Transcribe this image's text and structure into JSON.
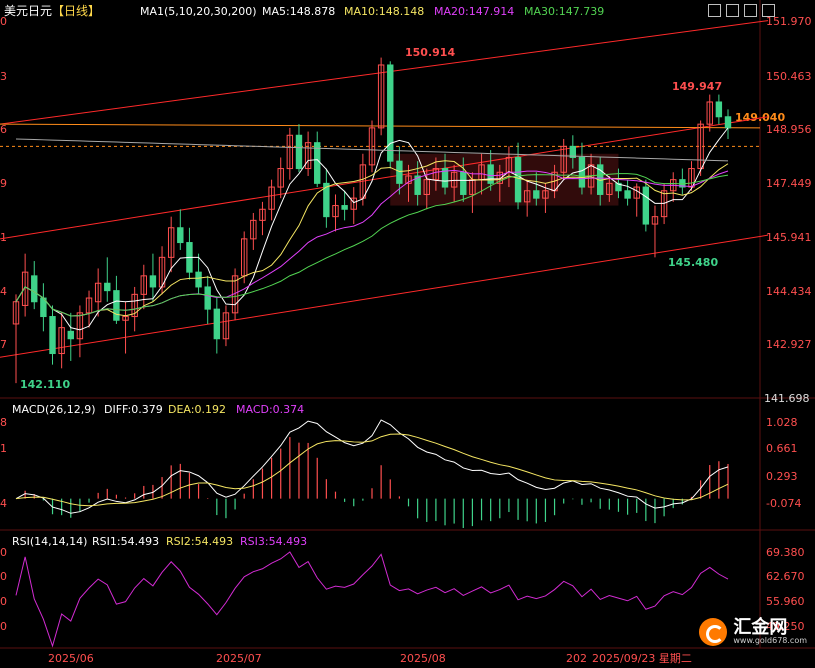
{
  "header": {
    "title": "美元日元",
    "period": "【日线】",
    "ma_label": "MA1(5,10,20,30,200)",
    "ma5": "MA5:148.878",
    "ma10": "MA10:148.148",
    "ma20": "MA20:147.914",
    "ma30": "MA30:147.739"
  },
  "macd_header": {
    "label": "MACD(26,12,9)",
    "diff": "DIFF:0.379",
    "dea": "DEA:0.192",
    "macd": "MACD:0.374"
  },
  "rsi_header": {
    "label": "RSI(14,14,14)",
    "rsi1": "RSI1:54.493",
    "rsi2": "RSI2:54.493",
    "rsi3": "RSI3:54.493"
  },
  "price_axis": [
    "151.970",
    "150.463",
    "148.956",
    "147.449",
    "145.941",
    "144.434",
    "142.927",
    "141.698"
  ],
  "macd_axis": [
    "1.028",
    "0.661",
    "0.293",
    "-0.074"
  ],
  "rsi_axis": [
    "69.380",
    "62.670",
    "55.960",
    "49.250"
  ],
  "left_axis_fragments": [
    "0",
    "3",
    "6",
    "9",
    "1",
    "4",
    "7",
    "8",
    "1",
    "4",
    "0",
    "0",
    "0",
    "0"
  ],
  "annotations": {
    "high": "150.914",
    "high2": "149.947",
    "last_price": "149.040",
    "low_recent": "145.480",
    "low": "142.110"
  },
  "x_axis": [
    "2025/06",
    "2025/07",
    "2025/08",
    "202",
    "2025/09/23 星期二"
  ],
  "watermark": {
    "text": "汇金网",
    "url": "www.gold678.com"
  },
  "colors": {
    "up": "#ff4f4f",
    "down": "#3fd38a",
    "ma5": "#ffffff",
    "ma10": "#f5e663",
    "ma20": "#e040fb",
    "ma30": "#52d452",
    "ma200": "#a8a8a8",
    "trend": "#ff2a2a",
    "macd_diff": "#ffffff",
    "macd_dea": "#f5e663",
    "rsi": "#d22bd2"
  },
  "chart_data": {
    "type": "candlestick",
    "title": "美元日元",
    "y_range": [
      141.698,
      151.97
    ],
    "candles": [
      {
        "o": 143.7,
        "h": 144.5,
        "l": 142.1,
        "c": 144.3
      },
      {
        "o": 144.2,
        "h": 145.6,
        "l": 143.9,
        "c": 145.1
      },
      {
        "o": 145.0,
        "h": 145.4,
        "l": 144.1,
        "c": 144.3
      },
      {
        "o": 144.4,
        "h": 144.8,
        "l": 143.5,
        "c": 143.9
      },
      {
        "o": 143.9,
        "h": 144.2,
        "l": 142.6,
        "c": 142.9
      },
      {
        "o": 142.9,
        "h": 144.0,
        "l": 142.5,
        "c": 143.6
      },
      {
        "o": 143.5,
        "h": 144.0,
        "l": 142.7,
        "c": 143.3
      },
      {
        "o": 143.3,
        "h": 144.2,
        "l": 142.8,
        "c": 144.0
      },
      {
        "o": 144.0,
        "h": 144.6,
        "l": 143.6,
        "c": 144.4
      },
      {
        "o": 144.3,
        "h": 145.2,
        "l": 143.9,
        "c": 144.8
      },
      {
        "o": 144.8,
        "h": 145.5,
        "l": 144.3,
        "c": 144.6
      },
      {
        "o": 144.6,
        "h": 145.0,
        "l": 143.7,
        "c": 143.8
      },
      {
        "o": 143.8,
        "h": 144.3,
        "l": 142.9,
        "c": 143.9
      },
      {
        "o": 143.9,
        "h": 144.7,
        "l": 143.5,
        "c": 144.5
      },
      {
        "o": 144.5,
        "h": 145.3,
        "l": 144.1,
        "c": 145.0
      },
      {
        "o": 145.0,
        "h": 145.6,
        "l": 144.3,
        "c": 144.7
      },
      {
        "o": 144.7,
        "h": 145.8,
        "l": 144.5,
        "c": 145.5
      },
      {
        "o": 145.5,
        "h": 146.6,
        "l": 145.1,
        "c": 146.3
      },
      {
        "o": 146.3,
        "h": 146.8,
        "l": 145.7,
        "c": 145.9
      },
      {
        "o": 145.9,
        "h": 146.3,
        "l": 144.9,
        "c": 145.1
      },
      {
        "o": 145.1,
        "h": 145.6,
        "l": 144.5,
        "c": 144.7
      },
      {
        "o": 144.7,
        "h": 145.0,
        "l": 143.7,
        "c": 144.1
      },
      {
        "o": 144.1,
        "h": 144.4,
        "l": 142.9,
        "c": 143.3
      },
      {
        "o": 143.3,
        "h": 144.2,
        "l": 143.1,
        "c": 144.0
      },
      {
        "o": 144.0,
        "h": 145.2,
        "l": 143.8,
        "c": 145.0
      },
      {
        "o": 145.0,
        "h": 146.2,
        "l": 144.8,
        "c": 146.0
      },
      {
        "o": 146.0,
        "h": 146.7,
        "l": 145.7,
        "c": 146.5
      },
      {
        "o": 146.5,
        "h": 147.0,
        "l": 146.1,
        "c": 146.8
      },
      {
        "o": 146.8,
        "h": 147.6,
        "l": 146.5,
        "c": 147.4
      },
      {
        "o": 147.4,
        "h": 148.2,
        "l": 147.1,
        "c": 147.9
      },
      {
        "o": 147.9,
        "h": 149.0,
        "l": 147.6,
        "c": 148.8
      },
      {
        "o": 148.8,
        "h": 149.1,
        "l": 147.8,
        "c": 147.9
      },
      {
        "o": 147.9,
        "h": 148.9,
        "l": 147.7,
        "c": 148.6
      },
      {
        "o": 148.6,
        "h": 148.9,
        "l": 147.4,
        "c": 147.5
      },
      {
        "o": 147.5,
        "h": 147.9,
        "l": 146.3,
        "c": 146.6
      },
      {
        "o": 146.6,
        "h": 147.2,
        "l": 146.2,
        "c": 146.9
      },
      {
        "o": 146.9,
        "h": 147.3,
        "l": 146.5,
        "c": 146.8
      },
      {
        "o": 146.8,
        "h": 147.4,
        "l": 146.4,
        "c": 147.1
      },
      {
        "o": 147.1,
        "h": 148.3,
        "l": 146.9,
        "c": 148.0
      },
      {
        "o": 148.0,
        "h": 149.2,
        "l": 147.8,
        "c": 149.0
      },
      {
        "o": 149.0,
        "h": 150.9,
        "l": 148.8,
        "c": 150.7
      },
      {
        "o": 150.7,
        "h": 150.8,
        "l": 147.9,
        "c": 148.1
      },
      {
        "o": 148.1,
        "h": 148.5,
        "l": 147.2,
        "c": 147.5
      },
      {
        "o": 147.5,
        "h": 148.0,
        "l": 147.0,
        "c": 147.7
      },
      {
        "o": 147.7,
        "h": 148.1,
        "l": 146.9,
        "c": 147.2
      },
      {
        "o": 147.2,
        "h": 147.9,
        "l": 146.8,
        "c": 147.6
      },
      {
        "o": 147.6,
        "h": 148.2,
        "l": 147.3,
        "c": 147.9
      },
      {
        "o": 147.9,
        "h": 148.3,
        "l": 147.2,
        "c": 147.4
      },
      {
        "o": 147.4,
        "h": 148.0,
        "l": 147.0,
        "c": 147.8
      },
      {
        "o": 147.8,
        "h": 148.2,
        "l": 147.0,
        "c": 147.2
      },
      {
        "o": 147.2,
        "h": 147.8,
        "l": 146.7,
        "c": 147.6
      },
      {
        "o": 147.6,
        "h": 148.3,
        "l": 147.2,
        "c": 148.0
      },
      {
        "o": 148.0,
        "h": 148.4,
        "l": 147.3,
        "c": 147.5
      },
      {
        "o": 147.5,
        "h": 148.0,
        "l": 147.0,
        "c": 147.8
      },
      {
        "o": 147.8,
        "h": 148.5,
        "l": 147.4,
        "c": 148.2
      },
      {
        "o": 148.2,
        "h": 148.6,
        "l": 146.8,
        "c": 147.0
      },
      {
        "o": 147.0,
        "h": 147.6,
        "l": 146.6,
        "c": 147.3
      },
      {
        "o": 147.3,
        "h": 147.8,
        "l": 146.9,
        "c": 147.1
      },
      {
        "o": 147.1,
        "h": 147.5,
        "l": 146.7,
        "c": 147.3
      },
      {
        "o": 147.3,
        "h": 148.0,
        "l": 147.1,
        "c": 147.8
      },
      {
        "o": 147.8,
        "h": 148.7,
        "l": 147.6,
        "c": 148.5
      },
      {
        "o": 148.5,
        "h": 148.8,
        "l": 147.9,
        "c": 148.2
      },
      {
        "o": 148.2,
        "h": 148.6,
        "l": 147.2,
        "c": 147.4
      },
      {
        "o": 147.4,
        "h": 148.3,
        "l": 147.2,
        "c": 148.0
      },
      {
        "o": 148.0,
        "h": 148.2,
        "l": 146.9,
        "c": 147.2
      },
      {
        "o": 147.2,
        "h": 147.7,
        "l": 147.0,
        "c": 147.5
      },
      {
        "o": 147.5,
        "h": 147.9,
        "l": 147.1,
        "c": 147.3
      },
      {
        "o": 147.3,
        "h": 147.6,
        "l": 146.9,
        "c": 147.1
      },
      {
        "o": 147.1,
        "h": 147.5,
        "l": 146.6,
        "c": 147.4
      },
      {
        "o": 147.4,
        "h": 147.6,
        "l": 146.2,
        "c": 146.4
      },
      {
        "o": 146.4,
        "h": 146.9,
        "l": 145.5,
        "c": 146.6
      },
      {
        "o": 146.6,
        "h": 147.5,
        "l": 146.4,
        "c": 147.3
      },
      {
        "o": 147.3,
        "h": 147.8,
        "l": 147.0,
        "c": 147.6
      },
      {
        "o": 147.6,
        "h": 147.9,
        "l": 147.2,
        "c": 147.4
      },
      {
        "o": 147.4,
        "h": 148.1,
        "l": 147.3,
        "c": 147.9
      },
      {
        "o": 147.9,
        "h": 149.2,
        "l": 147.7,
        "c": 149.1
      },
      {
        "o": 149.1,
        "h": 149.9,
        "l": 148.9,
        "c": 149.7
      },
      {
        "o": 149.7,
        "h": 149.9,
        "l": 149.1,
        "c": 149.3
      },
      {
        "o": 149.3,
        "h": 149.5,
        "l": 148.7,
        "c": 149.0
      }
    ],
    "macd": {
      "diff": 0.379,
      "dea": 0.192,
      "hist": 0.374,
      "y_ticks": [
        1.028,
        0.661,
        0.293,
        -0.074
      ]
    },
    "rsi": {
      "rsi1": 54.493,
      "rsi2": 54.493,
      "rsi3": 54.493,
      "y_ticks": [
        69.38,
        62.67,
        55.96,
        49.25
      ]
    }
  }
}
